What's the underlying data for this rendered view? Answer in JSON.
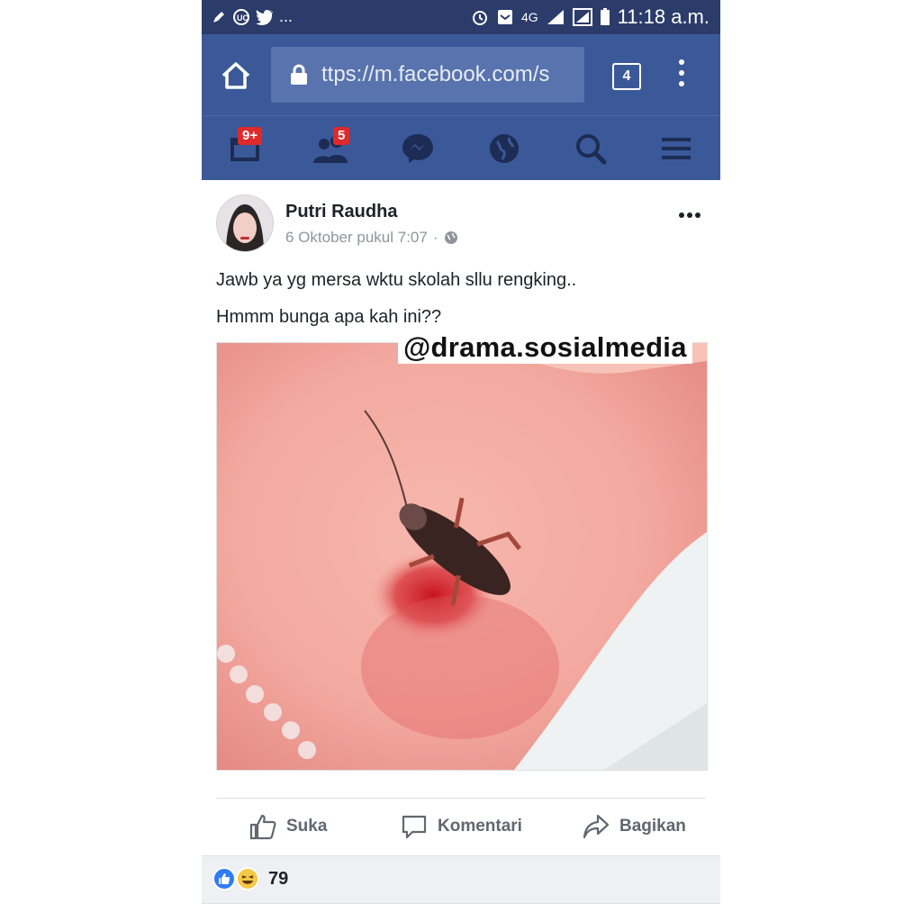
{
  "status_bar": {
    "left_icons": [
      "pen-icon",
      "uc-browser-icon",
      "twitter-icon"
    ],
    "ellipsis": "...",
    "network": "4G",
    "time": "11:18 a.m."
  },
  "browser": {
    "url": "ttps://m.facebook.com/s",
    "tab_count": "4"
  },
  "fb_nav": {
    "friend_requests_badge": "9+",
    "friends_badge": "5"
  },
  "post": {
    "author": "Putri Raudha",
    "timestamp": "6 Oktober pukul 7:07",
    "separator": "·",
    "text_line1": "Jawb ya yg mersa wktu skolah sllu rengking..",
    "text_line2": "Hmmm bunga apa kah ini??",
    "watermark": "@drama.sosialmedia"
  },
  "actions": {
    "like": "Suka",
    "comment": "Komentari",
    "share": "Bagikan"
  },
  "reactions": {
    "count": "79"
  },
  "colors": {
    "facebook_blue": "#3b5998",
    "status_bar": "#2b3b6a",
    "badge_red": "#e0292b"
  }
}
